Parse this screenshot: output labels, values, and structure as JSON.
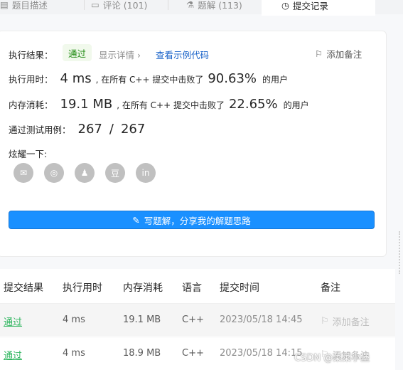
{
  "tabs": [
    {
      "label": "题目描述",
      "icon": "description-icon"
    },
    {
      "label": "评论 (101)",
      "icon": "comment-icon"
    },
    {
      "label": "题解 (113)",
      "icon": "flask-icon"
    },
    {
      "label": "提交记录",
      "icon": "clock-icon",
      "active": true
    }
  ],
  "result": {
    "status_label": "执行结果：",
    "status": "通过",
    "details_link": "显示详情 ›",
    "sample_code_link": "查看示例代码",
    "add_note": "添加备注",
    "runtime_label": "执行用时：",
    "runtime_value": "4 ms",
    "runtime_text": ", 在所有 C++ 提交中击败了",
    "runtime_pct": "90.63%",
    "runtime_suffix": "的用户",
    "memory_label": "内存消耗：",
    "memory_value": "19.1 MB",
    "memory_text": ", 在所有 C++ 提交中击败了",
    "memory_pct": "22.65%",
    "memory_suffix": "的用户",
    "tests_label": "通过测试用例：",
    "tests_passed": "267",
    "tests_sep": "/",
    "tests_total": "267",
    "share_label": "炫耀一下:",
    "share_icons": [
      "wechat-icon",
      "weibo-icon",
      "qq-icon",
      "douban-icon",
      "linkedin-icon"
    ],
    "share_glyphs": [
      "✉",
      "◎",
      "♟",
      "豆",
      "in"
    ],
    "write_button": "写题解，分享我的解题思路"
  },
  "table": {
    "headers": [
      "提交结果",
      "执行用时",
      "内存消耗",
      "语言",
      "提交时间",
      "备注"
    ],
    "rows": [
      {
        "result": "通过",
        "runtime": "4 ms",
        "memory": "19.1 MB",
        "lang": "C++",
        "time": "2023/05/18 14:45",
        "note": "添加备注"
      },
      {
        "result": "通过",
        "runtime": "4 ms",
        "memory": "18.9 MB",
        "lang": "C++",
        "time": "2023/05/18 14:15",
        "note": "添加备注"
      }
    ]
  },
  "watermark": "CSDN @菜菜小堡",
  "colors": {
    "accent": "#1a90ff",
    "success": "#2db55d",
    "link": "#1a63c9"
  }
}
